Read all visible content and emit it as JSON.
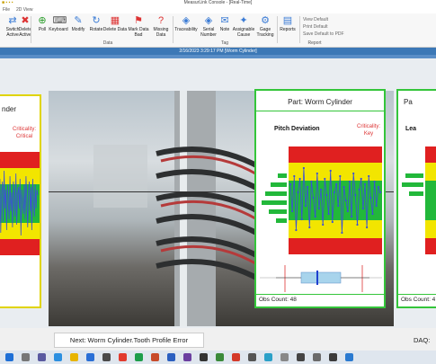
{
  "window": {
    "title": "MeasurLink Console - [Real-Time]",
    "qat": "■ ▪ ▪ ▪"
  },
  "tabs": [
    "File",
    "2D View"
  ],
  "ribbon": {
    "buttons": [
      {
        "label": "Switch Active",
        "icon": "switch-icon"
      },
      {
        "label": "Delete Active",
        "icon": "delete-icon"
      },
      {
        "label": "Poll",
        "icon": "plus-icon"
      },
      {
        "label": "Keyboard",
        "icon": "keyboard-icon"
      },
      {
        "label": "Modify",
        "icon": "edit-icon"
      },
      {
        "label": "Rotate",
        "icon": "rotate-icon"
      },
      {
        "label": "Delete Data",
        "icon": "delete-icon"
      },
      {
        "label": "Mark Data Bad",
        "icon": "flag-icon"
      },
      {
        "label": "Missing Data",
        "icon": "missing-icon"
      },
      {
        "label": "Traceability",
        "icon": "tag-icon"
      },
      {
        "label": "Serial Number",
        "icon": "tag-icon"
      },
      {
        "label": "Note",
        "icon": "note-icon"
      },
      {
        "label": "Assignable Cause",
        "icon": "cause-icon"
      },
      {
        "label": "Gage Tracking",
        "icon": "gage-icon"
      },
      {
        "label": "Reports",
        "icon": "report-icon"
      }
    ],
    "groups": {
      "data": "Data",
      "tag": "Tag",
      "report": "Report"
    },
    "report_items": [
      "View Default",
      "Print Default",
      "Save Default to PDF"
    ]
  },
  "status": "2/16/2023 3:29:17 PM [Worm Cylinder]",
  "panels": {
    "left": {
      "title": "nder",
      "criticality_label": "Criticality:",
      "criticality_value": "Critical",
      "obs": ""
    },
    "center": {
      "title": "Part: Worm Cylinder",
      "feature": "Pitch Deviation",
      "criticality_label": "Criticality:",
      "criticality_value": "Key",
      "obs_label": "Obs Count: 48"
    },
    "right": {
      "title": "Pa",
      "feature": "Lea",
      "obs_label": "Obs Count: 4"
    }
  },
  "footer": {
    "next": "Next: Worm Cylinder.Tooth Profile Error",
    "daq": "DAQ:"
  },
  "colors": {
    "panel_border": "#34c53a",
    "red_zone": "#e02020",
    "yellow_zone": "#f2e500",
    "green_zone": "#22b83a",
    "status_bar": "#3c78b6",
    "trace": "#3b4fd8"
  },
  "chart_data": {
    "type": "line",
    "series": [
      {
        "values": [
          0.6,
          -0.4,
          0.9,
          -1.1,
          0.3,
          0.8,
          -0.7,
          1.2,
          -0.2,
          0.5,
          -1.0,
          0.7,
          0.1,
          -0.6,
          1.0,
          -0.3,
          0.4,
          -0.9,
          0.8,
          0.2,
          -0.5,
          1.1,
          -0.8,
          0.3,
          0.6,
          -0.2,
          0.9,
          -1.2,
          0.5,
          0.0,
          -0.4,
          0.7,
          -0.6,
          1.0,
          0.2,
          -0.9,
          0.4,
          0.8,
          -0.3,
          0.6,
          -1.0,
          0.9,
          0.1,
          -0.5,
          0.7,
          -0.2,
          0.5,
          0.3
        ]
      }
    ],
    "zones": [
      "red",
      "yellow",
      "green",
      "yellow",
      "red"
    ]
  }
}
